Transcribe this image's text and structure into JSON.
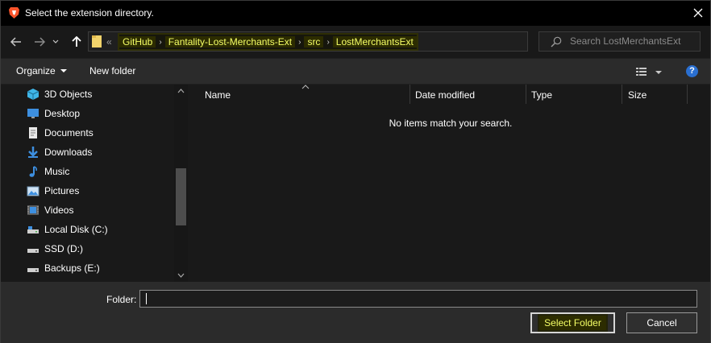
{
  "window": {
    "title": "Select the extension directory.",
    "app_icon": "brave-lion-icon",
    "close_icon": "close-icon"
  },
  "nav": {
    "back_icon": "arrow-left-icon",
    "forward_icon": "arrow-right-icon",
    "recent_icon": "chevron-down-icon",
    "up_icon": "arrow-up-icon",
    "address": {
      "prefix": "«",
      "crumbs": [
        "GitHub",
        "Fantality-Lost-Merchants-Ext",
        "src",
        "LostMerchantsExt"
      ],
      "separator": "›"
    },
    "refresh_icon": "refresh-icon",
    "search": {
      "placeholder": "Search LostMerchantsExt",
      "icon": "search-icon"
    }
  },
  "toolbar": {
    "organize_label": "Organize",
    "new_folder_label": "New folder",
    "view_icon": "view-details-icon",
    "help_label": "?"
  },
  "sidebar": {
    "items": [
      {
        "label": "3D Objects",
        "icon": "3d-objects-icon"
      },
      {
        "label": "Desktop",
        "icon": "desktop-icon"
      },
      {
        "label": "Documents",
        "icon": "documents-icon"
      },
      {
        "label": "Downloads",
        "icon": "downloads-icon"
      },
      {
        "label": "Music",
        "icon": "music-icon"
      },
      {
        "label": "Pictures",
        "icon": "pictures-icon"
      },
      {
        "label": "Videos",
        "icon": "videos-icon"
      },
      {
        "label": "Local Disk (C:)",
        "icon": "drive-icon"
      },
      {
        "label": "SSD (D:)",
        "icon": "drive-icon"
      },
      {
        "label": "Backups (E:)",
        "icon": "drive-icon"
      }
    ]
  },
  "content": {
    "columns": [
      "Name",
      "Date modified",
      "Type",
      "Size"
    ],
    "empty_message": "No items match your search."
  },
  "footer": {
    "folder_label": "Folder:",
    "folder_value": "",
    "select_button": "Select Folder",
    "cancel_button": "Cancel"
  },
  "colors": {
    "background": "#202020",
    "highlight_text": "#f5ff66",
    "accent_blue": "#2a6fd0"
  }
}
